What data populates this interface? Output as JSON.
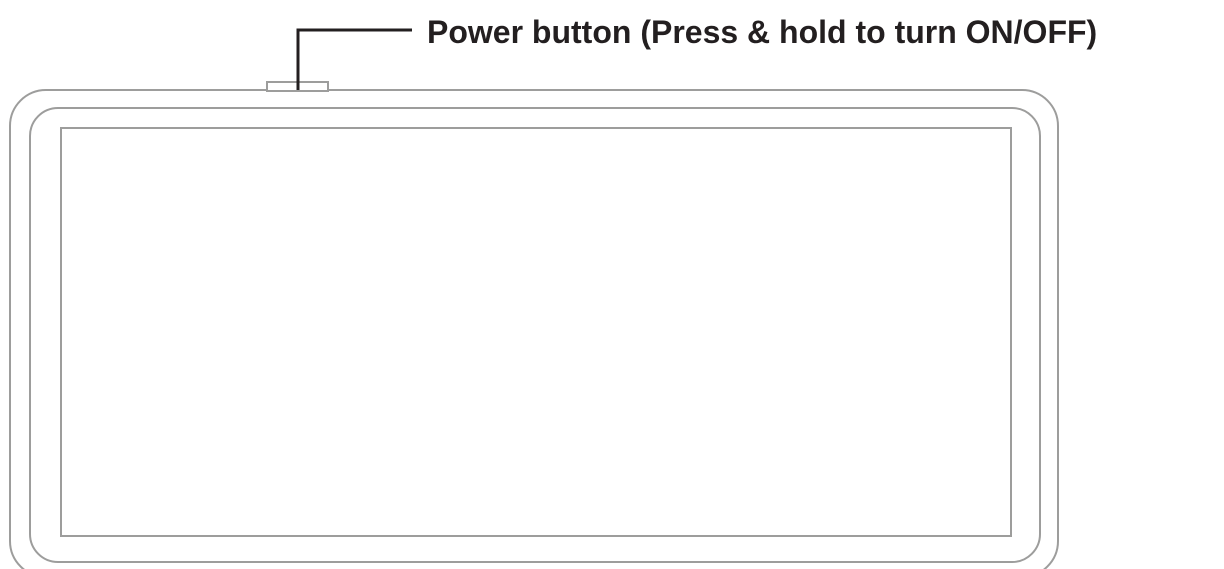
{
  "callout": {
    "label": "Power button (Press & hold to turn ON/OFF)"
  },
  "colors": {
    "outline": "#9d9d9c",
    "leader_line": "#231f20",
    "label_text": "#231f20",
    "background": "#ffffff"
  }
}
